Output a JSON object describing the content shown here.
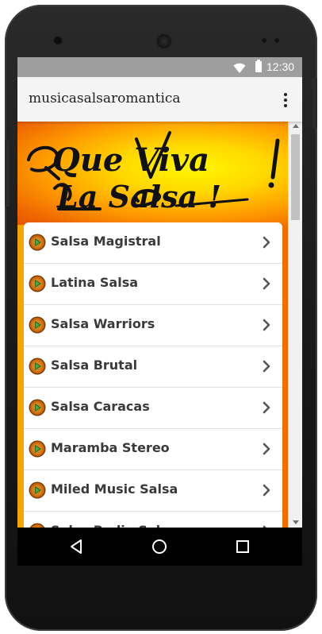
{
  "status_bar": {
    "time": "12:30",
    "icons": [
      "wifi-icon",
      "battery-icon"
    ]
  },
  "app_bar": {
    "title": "musicasalsaromantica",
    "menu_icon": "more-vert-icon"
  },
  "banner": {
    "line1": "Que Viva",
    "line2": "La Salsa !"
  },
  "stations": [
    {
      "label": "Salsa Magistral",
      "icon": "play-icon"
    },
    {
      "label": "Latina Salsa",
      "icon": "play-icon"
    },
    {
      "label": "Salsa Warriors",
      "icon": "play-icon"
    },
    {
      "label": "Salsa Brutal",
      "icon": "play-icon"
    },
    {
      "label": "Salsa Caracas",
      "icon": "play-icon"
    },
    {
      "label": "Maramba Stereo",
      "icon": "play-icon"
    },
    {
      "label": "Miled Music Salsa",
      "icon": "play-icon"
    },
    {
      "label": "Salsa Radio Salsa",
      "icon": "play-icon"
    }
  ],
  "nav_bar": {
    "buttons": [
      "back-icon",
      "home-icon",
      "recents-icon"
    ]
  },
  "colors": {
    "status_bar": "#9e9e9e",
    "app_bar": "#f4f4f4",
    "banner_yellow": "#ffe600",
    "banner_orange": "#f06a00",
    "item_text": "#3a3a3a",
    "play_icon": "#b5560a"
  }
}
